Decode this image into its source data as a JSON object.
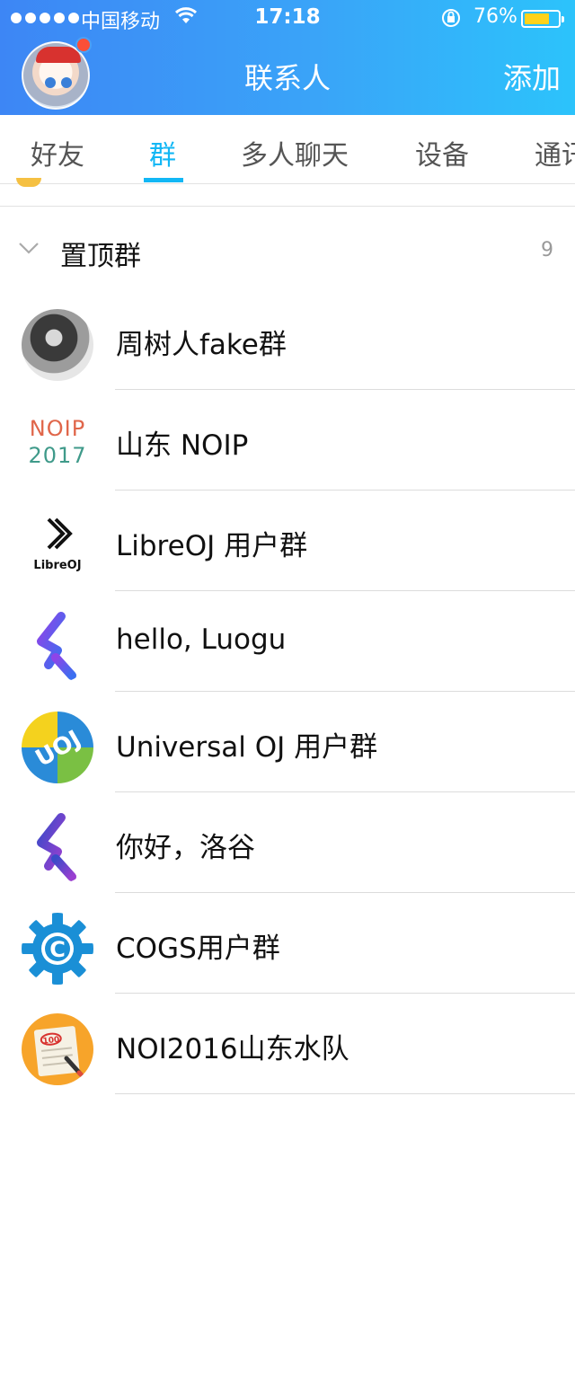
{
  "status_bar": {
    "carrier": "中国移动",
    "time": "17:18",
    "battery_percent_text": "76%",
    "battery_level": 0.76
  },
  "header": {
    "title": "联系人",
    "add_label": "添加",
    "accent_color": "#12b7f5",
    "badge_color": "#fb4f38"
  },
  "tabs": [
    {
      "label": "好友",
      "active": false
    },
    {
      "label": "群",
      "active": true
    },
    {
      "label": "多人聊天",
      "active": false
    },
    {
      "label": "设备",
      "active": false
    },
    {
      "label": "通讯录",
      "active": false
    }
  ],
  "section": {
    "title": "置顶群",
    "count": "9",
    "expanded": true
  },
  "groups": [
    {
      "name": "周树人fake群",
      "avatar": "photo-avatar"
    },
    {
      "name": "山东 NOIP",
      "avatar": "noip-2017-logo",
      "logo_text_top": "NOIP",
      "logo_text_bottom": "2017"
    },
    {
      "name": "LibreOJ 用户群",
      "avatar": "libreoj-logo",
      "logo_text": "LibreOJ"
    },
    {
      "name": "hello, Luogu",
      "avatar": "luogu-logo"
    },
    {
      "name": "Universal OJ 用户群",
      "avatar": "uoj-logo",
      "logo_text": "UOJ"
    },
    {
      "name": "你好，洛谷",
      "avatar": "luogu-logo"
    },
    {
      "name": "COGS用户群",
      "avatar": "cogs-gear-logo",
      "logo_text": "C"
    },
    {
      "name": "NOI2016山东水队",
      "avatar": "notepad-100-logo",
      "logo_text": "100"
    }
  ]
}
